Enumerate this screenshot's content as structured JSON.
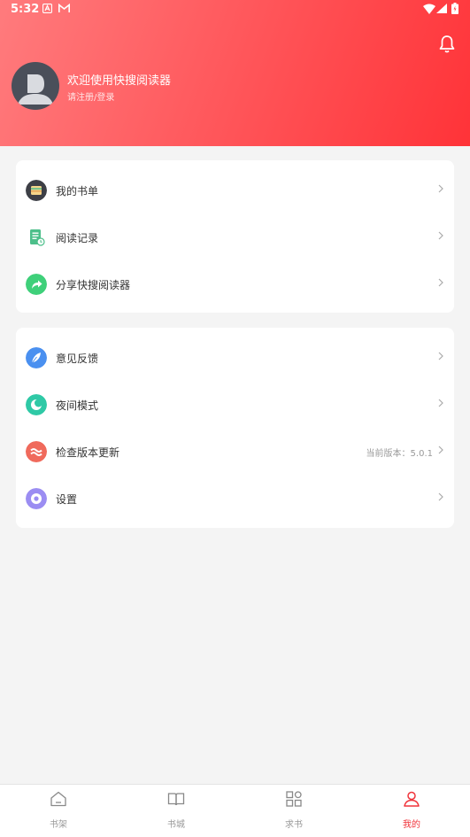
{
  "status_bar": {
    "time": "5:32"
  },
  "header": {
    "welcome_text": "欢迎使用快搜阅读器",
    "login_text": "请注册/登录"
  },
  "menu_group_1": [
    {
      "label": "我的书单",
      "icon": "booklist-icon"
    },
    {
      "label": "阅读记录",
      "icon": "history-icon"
    },
    {
      "label": "分享快搜阅读器",
      "icon": "share-icon"
    }
  ],
  "menu_group_2": [
    {
      "label": "意见反馈",
      "icon": "feedback-icon"
    },
    {
      "label": "夜间模式",
      "icon": "night-mode-icon"
    },
    {
      "label": "检查版本更新",
      "icon": "update-icon",
      "version_text": "当前版本：5.0.1"
    },
    {
      "label": "设置",
      "icon": "settings-icon"
    }
  ],
  "tab_bar": [
    {
      "label": "书架",
      "icon": "bookshelf-icon",
      "active": false
    },
    {
      "label": "书城",
      "icon": "bookstore-icon",
      "active": false
    },
    {
      "label": "求书",
      "icon": "request-icon",
      "active": false
    },
    {
      "label": "我的",
      "icon": "profile-icon",
      "active": true
    }
  ],
  "colors": {
    "accent": "#f0333a",
    "header_gradient_start": "#ff7b7d",
    "header_gradient_end": "#ff3338"
  }
}
